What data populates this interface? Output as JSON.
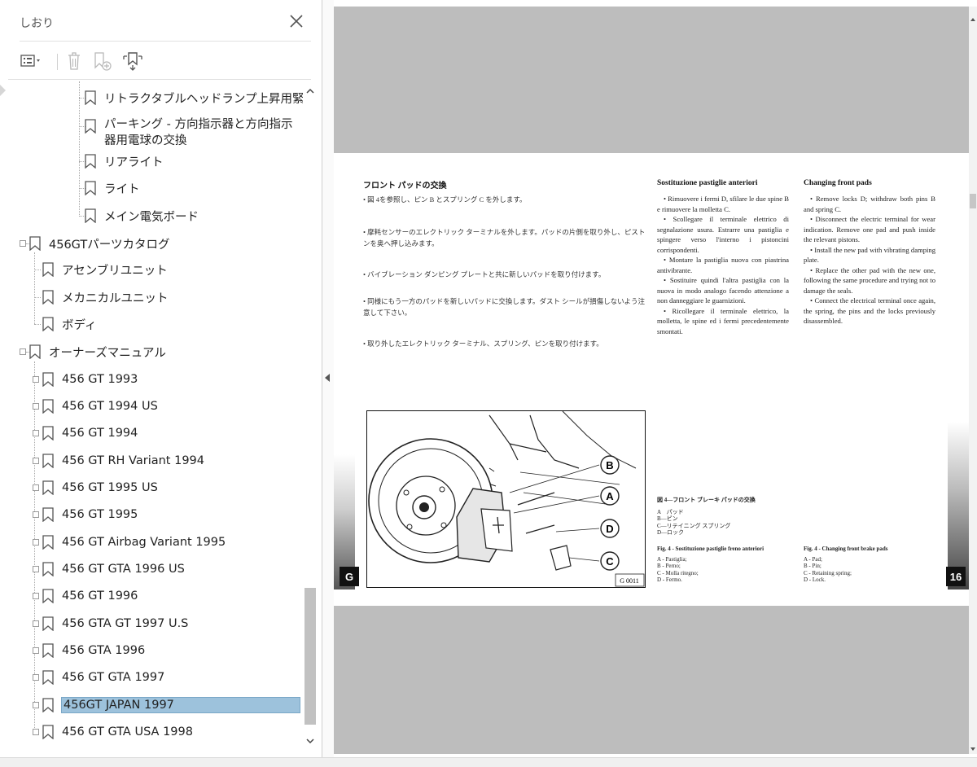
{
  "panel": {
    "title": "しおり",
    "toolbar": {
      "options_icon": "list-options-icon",
      "delete_icon": "trash-icon",
      "new_bookmark_icon": "add-bookmark-icon",
      "find_bookmark_icon": "find-bookmark-icon"
    }
  },
  "bookmarks": [
    {
      "label": "リトラクタブルヘッドランプ上昇用緊急装置"
    },
    {
      "label": "パーキング - 方向指示器と方向指示器用電球の交換"
    },
    {
      "label": "リアライト"
    },
    {
      "label": "ライト"
    },
    {
      "label": "メイン電気ボード"
    },
    {
      "label": "456GTパーツカタログ"
    },
    {
      "label": "アセンブリユニット"
    },
    {
      "label": "メカニカルユニット"
    },
    {
      "label": "ボディ"
    },
    {
      "label": "オーナーズマニュアル"
    },
    {
      "label": "456 GT 1993"
    },
    {
      "label": "456 GT 1994 US"
    },
    {
      "label": "456 GT 1994"
    },
    {
      "label": "456 GT RH Variant 1994"
    },
    {
      "label": "456 GT 1995 US"
    },
    {
      "label": "456 GT 1995"
    },
    {
      "label": "456 GT Airbag Variant 1995"
    },
    {
      "label": "456 GT GTA 1996 US"
    },
    {
      "label": "456 GT 1996"
    },
    {
      "label": "456 GTA GT 1997 U.S"
    },
    {
      "label": "456 GTA  1996"
    },
    {
      "label": "456 GT GTA 1997"
    },
    {
      "label": "456GT JAPAN 1997"
    },
    {
      "label": "456 GT GTA USA 1998"
    }
  ],
  "doc": {
    "jp": {
      "title": "フロント パッドの交換",
      "items": [
        "• 図 4を参照し、ピン B とスプリング C を外します。",
        "• 摩耗センサーのエレクトリック ターミナルを外します。パッドの片側を取り外し、ピストンを奥へ押し込みます。",
        "• バイブレーション ダンピング プレートと共に新しいパッドを取り付けます。",
        "• 同様にもう一方のパッドを新しいパッドに交換します。ダスト シールが損傷しないよう注意して下さい。",
        "• 取り外したエレクトリック ターミナル、スプリング、ピンを取り付けます。"
      ]
    },
    "it": {
      "title": "Sostituzione pastiglie anteriori",
      "paragraphs": [
        "• Rimuovere i fermi D, sfilare le due spine B e rimuovere la molletta C.",
        "• Scollegare il terminale elettrico di segnalazione usura. Estrarre una pastiglia e spingere verso l'interno i pistoncini corrispondenti.",
        "• Montare la pastiglia nuova con piastrina antivibrante.",
        "• Sostituire quindi l'altra pastiglia con la nuova in modo analogo facendo attenzione a non danneggiare le guarnizioni.",
        "• Ricollegare il terminale elettrico, la molletta, le spine ed i fermi precedentemente smontati."
      ]
    },
    "en": {
      "title": "Changing front pads",
      "paragraphs": [
        "• Remove locks D; withdraw both pins B and spring C.",
        "• Disconnect the electric terminal for wear indication. Remove one pad and push inside the relevant pistons.",
        "• Install the new pad with vibrating damping plate.",
        "• Replace the other pad with the new one, following the same procedure and trying not to damage the seals.",
        "• Connect the electrical terminal once again, the spring, the pins and the locks previously disassembled."
      ]
    },
    "figure": {
      "code": "G 0011",
      "callouts": [
        "B",
        "A",
        "D",
        "C"
      ]
    },
    "caption_jp": {
      "title": "図 4—フロント ブレーキ パッドの交換",
      "lines": [
        "A　パッド",
        "B—ピン",
        "C—リテイニング スプリング",
        "D—ロック"
      ]
    },
    "caption_it": {
      "title": "Fig. 4 - Sostituzione pastiglie freno anteriori",
      "lines": [
        "A - Pastiglia;",
        "B - Perno;",
        "C - Molla ritegno;",
        "D - Fermo."
      ]
    },
    "caption_en": {
      "title": "Fig. 4 - Changing front brake pads",
      "lines": [
        "A - Pad;",
        "B - Pin;",
        "C - Retaining spring;",
        "D - Lock."
      ]
    },
    "left_tab": "G",
    "page_number": "16"
  }
}
